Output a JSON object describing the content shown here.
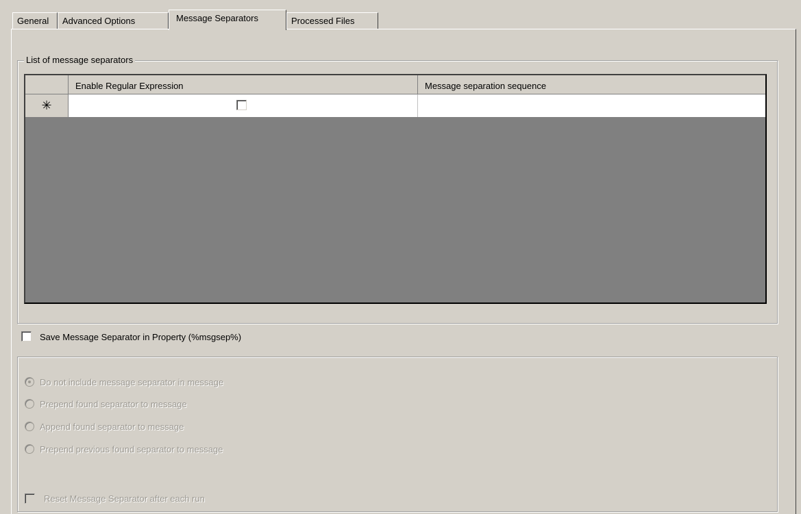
{
  "tabs": [
    {
      "label": "General"
    },
    {
      "label": "Advanced Options"
    },
    {
      "label": "Message Separators",
      "active": true
    },
    {
      "label": "Processed Files"
    }
  ],
  "separators_group": {
    "title": "List of message separators",
    "grid": {
      "columns": [
        "Enable Regular Expression",
        "Message separation sequence"
      ],
      "new_row_marker": "✳",
      "rows": [
        {
          "enable_regex": false,
          "sequence": ""
        }
      ]
    }
  },
  "save_separator_checkbox": {
    "label": "Save Message Separator in Property (%msgsep%)",
    "checked": false
  },
  "options_group": {
    "enabled": false,
    "radios": [
      {
        "label": "Do not include message separator in message",
        "selected": true
      },
      {
        "label": "Prepend found separator to message",
        "selected": false
      },
      {
        "label": "Append found separator to message",
        "selected": false
      },
      {
        "label": "Prepend previous found separator to message",
        "selected": false
      }
    ],
    "reset_checkbox": {
      "label": "Reset Message Separator after each run",
      "checked": false
    }
  },
  "colors": {
    "background": "#d4d0c8",
    "grid_empty": "#808080",
    "disabled_text": "#9d9a93"
  }
}
